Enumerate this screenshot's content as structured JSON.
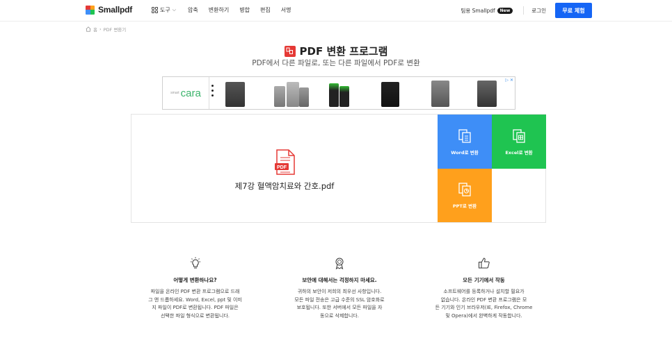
{
  "header": {
    "brand": "Smallpdf",
    "nav": {
      "tools_label": "도구",
      "items": [
        "압축",
        "변환하기",
        "병합",
        "편집",
        "서명"
      ]
    },
    "team_label": "팀용 Smallpdf",
    "new_badge": "New",
    "login_label": "로그인",
    "trial_label": "무료 체험"
  },
  "breadcrumb": {
    "home": "홈",
    "separator": "›",
    "current": "PDF 변환기"
  },
  "page": {
    "title": "PDF 변환 프로그램",
    "subtitle": "PDF에서 다른 파일로, 또는 다른 파일에서 PDF로 변환"
  },
  "ad": {
    "brand_small": "smart",
    "brand_name": "cara",
    "close_icon": "close-icon",
    "info_icon": "adchoices-icon"
  },
  "converter": {
    "file_name": "제7강 혈액암치료와 간호.pdf",
    "file_icon_label": "PDF",
    "options": {
      "word": "Word로 변환",
      "excel": "Excel로 변환",
      "ppt": "PPT로 변환"
    },
    "colors": {
      "word": "#3e8ef7",
      "excel": "#1fc451",
      "ppt": "#ffa01c",
      "pdf": "#e53935",
      "accent": "#1565f5"
    }
  },
  "features": [
    {
      "icon": "lightbulb-icon",
      "title": "어떻게 변환하나요?",
      "lines": [
        "파일을 온라인 PDF 변환 프로그램으로 드래",
        "그 앤 드롭하세요. Word, Excel, ppt 및 이미",
        "지 파일이 PDF로 변환됩니다. PDF 파일은",
        "선택한 파일 형식으로 변환됩니다."
      ]
    },
    {
      "icon": "award-ribbon-icon",
      "title": "보안에 대해서는 걱정하지 마세요.",
      "lines": [
        "귀하의 보안이 저희의 최우선 사항입니다.",
        "모든 파일 전송은 고급 수준의 SSL 암호화로",
        "보호됩니다. 또한 서버에서 모든 파일을 자",
        "동으로 삭제합니다."
      ]
    },
    {
      "icon": "thumbs-up-icon",
      "title": "모든 기기에서 작동",
      "lines": [
        "소프트웨어를 등록하거나 설치할 필요가",
        "없습니다. 온라인 PDF 변환 프로그램은 모",
        "든 기기와 인기 브라우저(IE, Firefox, Chrome",
        "및 Opera)에서 완벽하게 작동합니다."
      ]
    }
  ]
}
